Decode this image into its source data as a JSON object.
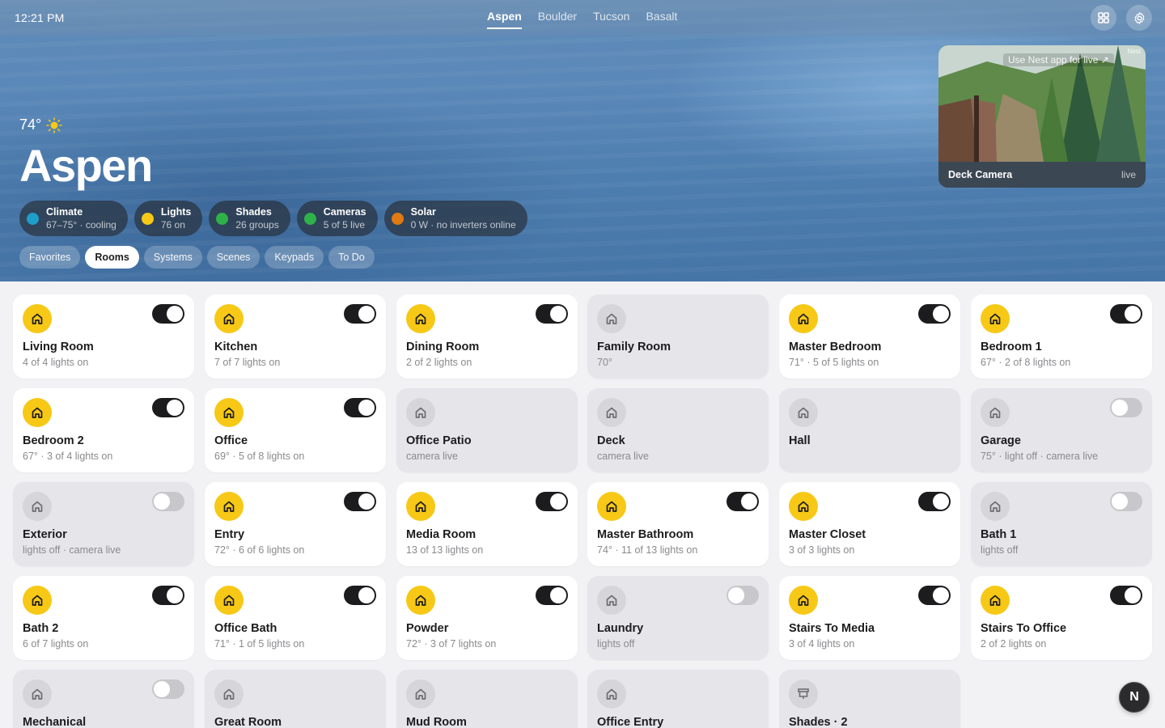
{
  "topbar": {
    "time": "12:21 PM",
    "cities": [
      {
        "label": "Aspen",
        "active": true
      },
      {
        "label": "Boulder",
        "active": false
      },
      {
        "label": "Tucson",
        "active": false
      },
      {
        "label": "Basalt",
        "active": false
      }
    ],
    "grid_icon": "grid-icon",
    "settings_icon": "gear-icon"
  },
  "hero": {
    "temperature": "74°",
    "weather_icon": "sun-icon",
    "city": "Aspen",
    "status": [
      {
        "title": "Climate",
        "sub": "67–75° · cooling",
        "color": "#1e9ec9"
      },
      {
        "title": "Lights",
        "sub": "76 on",
        "color": "#f7c816"
      },
      {
        "title": "Shades",
        "sub": "26 groups",
        "color": "#2fb14a"
      },
      {
        "title": "Cameras",
        "sub": "5 of 5 live",
        "color": "#2fb14a"
      },
      {
        "title": "Solar",
        "sub": "0 W · no inverters online",
        "color": "#e07a12"
      }
    ],
    "views": [
      {
        "label": "Favorites",
        "active": false
      },
      {
        "label": "Rooms",
        "active": true
      },
      {
        "label": "Systems",
        "active": false
      },
      {
        "label": "Scenes",
        "active": false
      },
      {
        "label": "Keypads",
        "active": false
      },
      {
        "label": "To Do",
        "active": false
      }
    ]
  },
  "camera": {
    "name": "Deck Camera",
    "status": "live",
    "hint": "Use Nest app for live ↗",
    "tag": "Nest"
  },
  "rooms": [
    {
      "name": "Living Room",
      "sub": "4 of 4 lights on",
      "active": true,
      "toggle": "on",
      "icon": "house-icon"
    },
    {
      "name": "Kitchen",
      "sub": "7 of 7 lights on",
      "active": true,
      "toggle": "on",
      "icon": "house-icon"
    },
    {
      "name": "Dining Room",
      "sub": "2 of 2 lights on",
      "active": true,
      "toggle": "on",
      "icon": "house-icon"
    },
    {
      "name": "Family Room",
      "sub": "70°",
      "active": false,
      "toggle": "none",
      "icon": "house-icon"
    },
    {
      "name": "Master Bedroom",
      "sub": "71° · 5 of 5 lights on",
      "active": true,
      "toggle": "on",
      "icon": "house-icon"
    },
    {
      "name": "Bedroom 1",
      "sub": "67° · 2 of 8 lights on",
      "active": true,
      "toggle": "on",
      "icon": "house-icon"
    },
    {
      "name": "Bedroom 2",
      "sub": "67° · 3 of 4 lights on",
      "active": true,
      "toggle": "on",
      "icon": "house-icon"
    },
    {
      "name": "Office",
      "sub": "69° · 5 of 8 lights on",
      "active": true,
      "toggle": "on",
      "icon": "house-icon"
    },
    {
      "name": "Office Patio",
      "sub": "camera live",
      "active": false,
      "toggle": "none",
      "icon": "house-icon"
    },
    {
      "name": "Deck",
      "sub": "camera live",
      "active": false,
      "toggle": "none",
      "icon": "house-icon"
    },
    {
      "name": "Hall",
      "sub": "",
      "active": false,
      "toggle": "none",
      "icon": "house-icon"
    },
    {
      "name": "Garage",
      "sub": "75° · light off · camera live",
      "active": false,
      "toggle": "off",
      "icon": "house-icon"
    },
    {
      "name": "Exterior",
      "sub": "lights off · camera live",
      "active": false,
      "toggle": "off",
      "icon": "house-icon"
    },
    {
      "name": "Entry",
      "sub": "72° · 6 of 6 lights on",
      "active": true,
      "toggle": "on",
      "icon": "house-icon"
    },
    {
      "name": "Media Room",
      "sub": "13 of 13 lights on",
      "active": true,
      "toggle": "on",
      "icon": "house-icon"
    },
    {
      "name": "Master Bathroom",
      "sub": "74° · 11 of 13 lights on",
      "active": true,
      "toggle": "on",
      "icon": "house-icon"
    },
    {
      "name": "Master Closet",
      "sub": "3 of 3 lights on",
      "active": true,
      "toggle": "on",
      "icon": "house-icon"
    },
    {
      "name": "Bath 1",
      "sub": "lights off",
      "active": false,
      "toggle": "off",
      "icon": "house-icon"
    },
    {
      "name": "Bath 2",
      "sub": "6 of 7 lights on",
      "active": true,
      "toggle": "on",
      "icon": "house-icon"
    },
    {
      "name": "Office Bath",
      "sub": "71° · 1 of 5 lights on",
      "active": true,
      "toggle": "on",
      "icon": "house-icon"
    },
    {
      "name": "Powder",
      "sub": "72° · 3 of 7 lights on",
      "active": true,
      "toggle": "on",
      "icon": "house-icon"
    },
    {
      "name": "Laundry",
      "sub": "lights off",
      "active": false,
      "toggle": "off",
      "icon": "house-icon"
    },
    {
      "name": "Stairs To Media",
      "sub": "3 of 4 lights on",
      "active": true,
      "toggle": "on",
      "icon": "house-icon"
    },
    {
      "name": "Stairs To Office",
      "sub": "2 of 2 lights on",
      "active": true,
      "toggle": "on",
      "icon": "house-icon"
    },
    {
      "name": "Mechanical",
      "sub": "",
      "active": false,
      "toggle": "off",
      "icon": "house-icon"
    },
    {
      "name": "Great Room",
      "sub": "",
      "active": false,
      "toggle": "none",
      "icon": "house-icon"
    },
    {
      "name": "Mud Room",
      "sub": "",
      "active": false,
      "toggle": "none",
      "icon": "house-icon"
    },
    {
      "name": "Office Entry",
      "sub": "",
      "active": false,
      "toggle": "none",
      "icon": "house-icon"
    },
    {
      "name": "Shades · 2",
      "sub": "",
      "active": false,
      "toggle": "none",
      "icon": "shade-icon"
    }
  ],
  "fab": {
    "label": "N"
  }
}
